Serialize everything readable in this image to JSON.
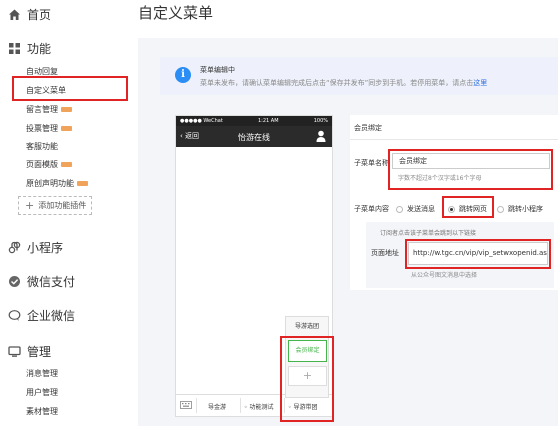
{
  "sidebar": {
    "home": "首页",
    "functions": "功能",
    "items": [
      {
        "label": "自动回复",
        "new": false
      },
      {
        "label": "自定义菜单",
        "new": false
      },
      {
        "label": "留言管理",
        "new": true
      },
      {
        "label": "投票管理",
        "new": true
      },
      {
        "label": "客服功能",
        "new": false
      },
      {
        "label": "页面模版",
        "new": true
      },
      {
        "label": "原创声明功能",
        "new": true
      }
    ],
    "add_plugin": "添加功能插件",
    "mini_program": "小程序",
    "wechat_pay": "微信支付",
    "enterprise_wechat": "企业微信",
    "manage": "管理",
    "manage_items": [
      "消息管理",
      "用户管理",
      "素材管理"
    ]
  },
  "page": {
    "title": "自定义菜单"
  },
  "notice": {
    "title": "菜单编辑中",
    "text_before": "菜单未发布，请确认菜单编辑完成后点击“保存并发布”同步到手机。若停用菜单，请点击",
    "link": "这里"
  },
  "phone": {
    "carrier": "●●●●● WeChat",
    "time": "1:21 AM",
    "battery": "100%",
    "back": "返回",
    "account_name": "怡游在线",
    "menu": [
      "导金游",
      "功能测试",
      "导游带团"
    ],
    "popup_items": [
      "导游选团",
      "会员绑定"
    ],
    "add": "+"
  },
  "form": {
    "section_title": "会员绑定",
    "name_label": "子菜单名称",
    "name_value": "会员绑定",
    "name_hint": "字数不超过8个汉字或16个字母",
    "content_label": "子菜单内容",
    "options": [
      "发送消息",
      "跳转网页",
      "跳转小程序"
    ],
    "selected_option": "跳转网页",
    "sub_caption": "订阅者点击该子菜单会跳到以下链接",
    "url_label": "页面地址",
    "url_value": "http://w.tgc.cn/vip/vip_setwxopenid.as",
    "url_under": "从公众号图文消息中选择"
  },
  "colors": {
    "accent_green": "#44b549",
    "highlight_red": "#e02424",
    "info_blue": "#2a8ef5"
  }
}
